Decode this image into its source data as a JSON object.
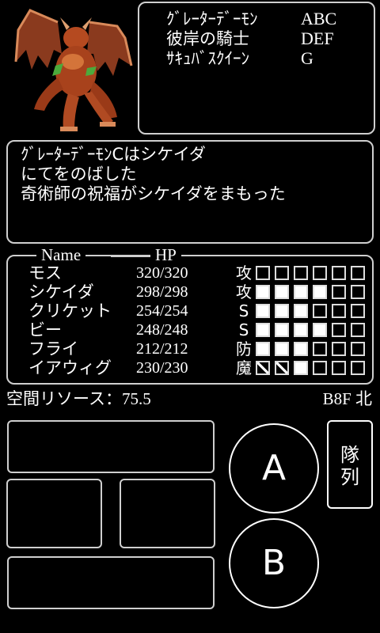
{
  "enemies": [
    {
      "name": "ｸﾞﾚｰﾀｰﾃﾞｰﾓﾝ",
      "code": "ABC"
    },
    {
      "name": "彼岸の騎士",
      "code": "DEF"
    },
    {
      "name": "ｻｷｭﾊﾞｽｸｲｰﾝ",
      "code": "G"
    }
  ],
  "message": {
    "lines": [
      "ｸﾞﾚｰﾀｰﾃﾞｰﾓﾝCはシケイダ",
      "にてをのばした",
      "奇術師の祝福がシケイダをまもった"
    ]
  },
  "party": {
    "header_name": "Name",
    "header_hp": "HP",
    "members": [
      {
        "name": "モス",
        "hp": "320/320",
        "stat": "攻",
        "gauge": [
          "e",
          "e",
          "e",
          "e",
          "e",
          "e"
        ]
      },
      {
        "name": "シケイダ",
        "hp": "298/298",
        "stat": "攻",
        "gauge": [
          "f",
          "f",
          "f",
          "f",
          "e",
          "e"
        ]
      },
      {
        "name": "クリケット",
        "hp": "254/254",
        "stat": "S",
        "gauge": [
          "f",
          "f",
          "f",
          "e",
          "e",
          "e"
        ]
      },
      {
        "name": "ビー",
        "hp": "248/248",
        "stat": "S",
        "gauge": [
          "f",
          "f",
          "f",
          "f",
          "e",
          "e"
        ]
      },
      {
        "name": "フライ",
        "hp": "212/212",
        "stat": "防",
        "gauge": [
          "f",
          "f",
          "f",
          "e",
          "e",
          "e"
        ]
      },
      {
        "name": "イアウィグ",
        "hp": "230/230",
        "stat": "魔",
        "gauge": [
          "d",
          "d",
          "f",
          "e",
          "e",
          "e"
        ]
      }
    ]
  },
  "status": {
    "space_resource": "空間リソース：75.5",
    "location": "B8F 北"
  },
  "controls": {
    "a_label": "A",
    "b_label": "B",
    "formation_line1": "隊",
    "formation_line2": "列"
  },
  "icons": {
    "monster": "winged-demon-sprite"
  },
  "colors": {
    "background": "#000000",
    "frame": "#cfcfcf",
    "text": "#ffffff"
  }
}
